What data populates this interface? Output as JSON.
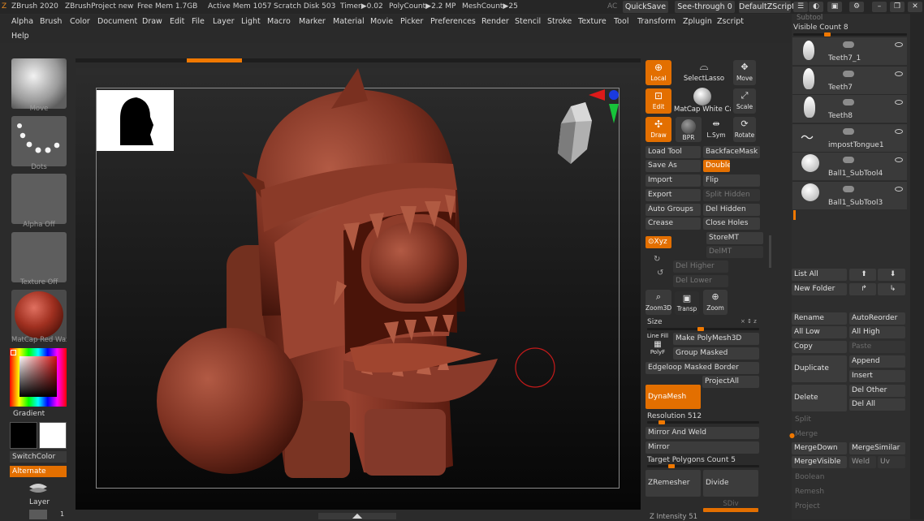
{
  "titlebar": {
    "app": "ZBrush 2020",
    "project": "ZBrushProject new",
    "free_mem": "Free Mem 1.7GB",
    "active_mem": "Active Mem 1057",
    "scratch": "Scratch Disk 503",
    "timer": "Timer▶0.02",
    "polycount": "PolyCount▶2.2 MP",
    "meshcount": "MeshCount▶25",
    "ac": "AC",
    "quicksave": "QuickSave",
    "seethrough": "See-through",
    "seethrough_value": "0",
    "script": "DefaultZScript",
    "subtool_header": "Subtool"
  },
  "menu": {
    "items": [
      "Alpha",
      "Brush",
      "Color",
      "Document",
      "Draw",
      "Edit",
      "File",
      "Layer",
      "Light",
      "Macro",
      "Marker",
      "Material",
      "Movie",
      "Picker",
      "Preferences",
      "Render",
      "Stencil",
      "Stroke",
      "Texture",
      "Tool",
      "Transform",
      "Zplugin",
      "Zscript"
    ],
    "help": "Help"
  },
  "leftshelf": {
    "brush": "Move",
    "stroke": "Dots",
    "alpha": "Alpha Off",
    "texture": "Texture Off",
    "material": "MatCap Red Wax",
    "gradient": "Gradient",
    "switchcolor": "SwitchColor",
    "alternate": "Alternate",
    "layer": "Layer",
    "bottom_num": "1"
  },
  "shelf": {
    "local": "Local",
    "selectlasso": "SelectLasso",
    "move": "Move",
    "edit": "Edit",
    "matcap": "MatCap White Cavity",
    "scale": "Scale",
    "draw": "Draw",
    "bpr": "BPR",
    "lsym": "L.Sym",
    "rotate": "Rotate",
    "xyz": "Xyz",
    "zoom3d": "Zoom3D",
    "transp": "Transp",
    "zoom": "Zoom",
    "linefill": "Line Fill",
    "polyf": "PolyF"
  },
  "toolpanel": {
    "load_tool": "Load Tool",
    "backface": "BackfaceMask",
    "save_as": "Save As",
    "double": "Double",
    "import": "Import",
    "flip": "Flip",
    "export": "Export",
    "split_hidden": "Split Hidden",
    "auto_groups": "Auto Groups",
    "del_hidden": "Del Hidden",
    "crease": "Crease",
    "close_holes": "Close Holes",
    "storemt": "StoreMT",
    "delmt": "DelMT",
    "del_higher": "Del Higher",
    "del_lower": "Del Lower",
    "size": "Size",
    "size_marks": "× ↕ z",
    "make_polymesh": "Make PolyMesh3D",
    "group_masked": "Group Masked",
    "edgeloop": "Edgeloop Masked Border",
    "projectall": "ProjectAll",
    "dynamesh": "DynaMesh",
    "resolution": "Resolution 512",
    "mirror_weld": "Mirror And Weld",
    "mirror": "Mirror",
    "target_poly": "Target Polygons Count 5",
    "zremesher": "ZRemesher",
    "divide": "Divide",
    "sdiv": "SDiv",
    "z_intensity": "Z Intensity 51"
  },
  "subtool": {
    "visible_count": "Visible Count",
    "visible_value": "8",
    "items": [
      {
        "name": "Teeth7_1"
      },
      {
        "name": "Teeth7"
      },
      {
        "name": "Teeth8"
      },
      {
        "name": "impostTongue1"
      },
      {
        "name": "Ball1_SubTool4"
      },
      {
        "name": "Ball1_SubTool3"
      }
    ],
    "list_all": "List All",
    "new_folder": "New Folder",
    "rename": "Rename",
    "autoreorder": "AutoReorder",
    "all_low": "All Low",
    "all_high": "All High",
    "copy": "Copy",
    "paste": "Paste",
    "duplicate": "Duplicate",
    "append": "Append",
    "insert": "Insert",
    "delete": "Delete",
    "del_other": "Del Other",
    "del_all": "Del All",
    "split": "Split",
    "merge": "Merge",
    "mergedown": "MergeDown",
    "mergesimilar": "MergeSimilar",
    "mergevisible": "MergeVisible",
    "weld": "Weld",
    "uv": "Uv",
    "boolean": "Boolean",
    "remesh": "Remesh",
    "project": "Project"
  },
  "colors": {
    "accent": "#e36f00",
    "clay": "#8a3a2a",
    "panel": "#3a3a3a"
  }
}
